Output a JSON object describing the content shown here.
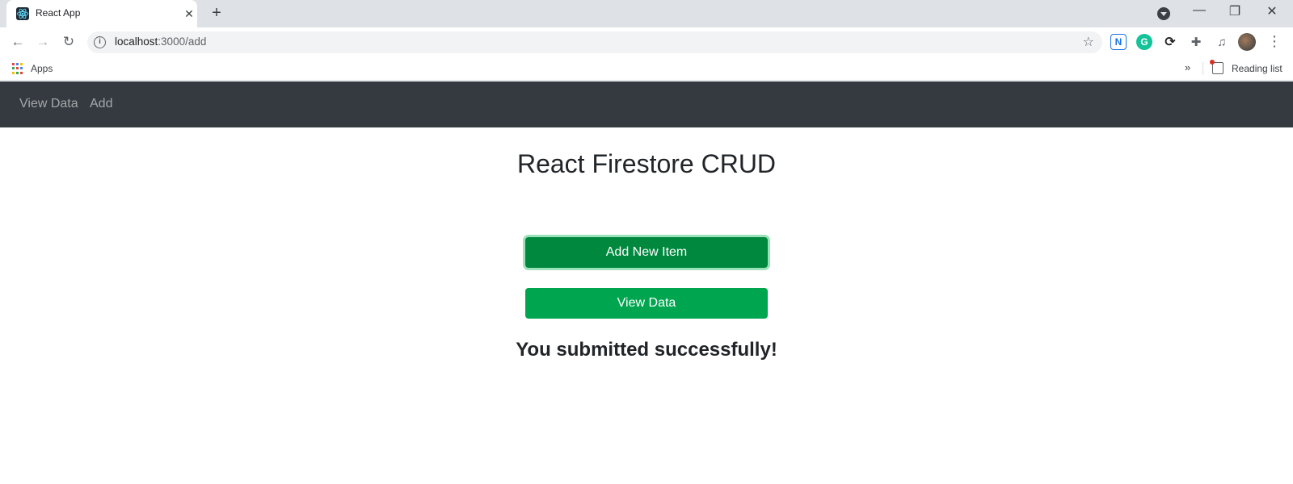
{
  "browser": {
    "tab": {
      "title": "React App",
      "close_glyph": "✕"
    },
    "new_tab_glyph": "+",
    "window_controls": {
      "minimize": "—",
      "restore": "❐",
      "close": "✕"
    },
    "toolbar": {
      "url_host": "localhost",
      "url_path": ":3000/add",
      "back_glyph": "←",
      "forward_glyph": "→",
      "reload_glyph": "↻",
      "star_glyph": "☆",
      "menu_glyph": "⋮",
      "extensions": {
        "notion": "N",
        "grammarly": "G",
        "sync": "⟳",
        "puzzle": "✚",
        "media": "♫"
      }
    },
    "bookmarks": {
      "apps_label": "Apps",
      "more_glyph": "»",
      "reading_list_label": "Reading list"
    }
  },
  "navbar": {
    "links": [
      "View Data",
      "Add"
    ],
    "background": "#343a40"
  },
  "main": {
    "title": "React Firestore CRUD",
    "add_button_label": "Add New Item",
    "view_button_label": "View Data",
    "success_message": "You submitted successfully!"
  },
  "colors": {
    "add_button": "#00883e",
    "view_button": "#00a54f"
  }
}
